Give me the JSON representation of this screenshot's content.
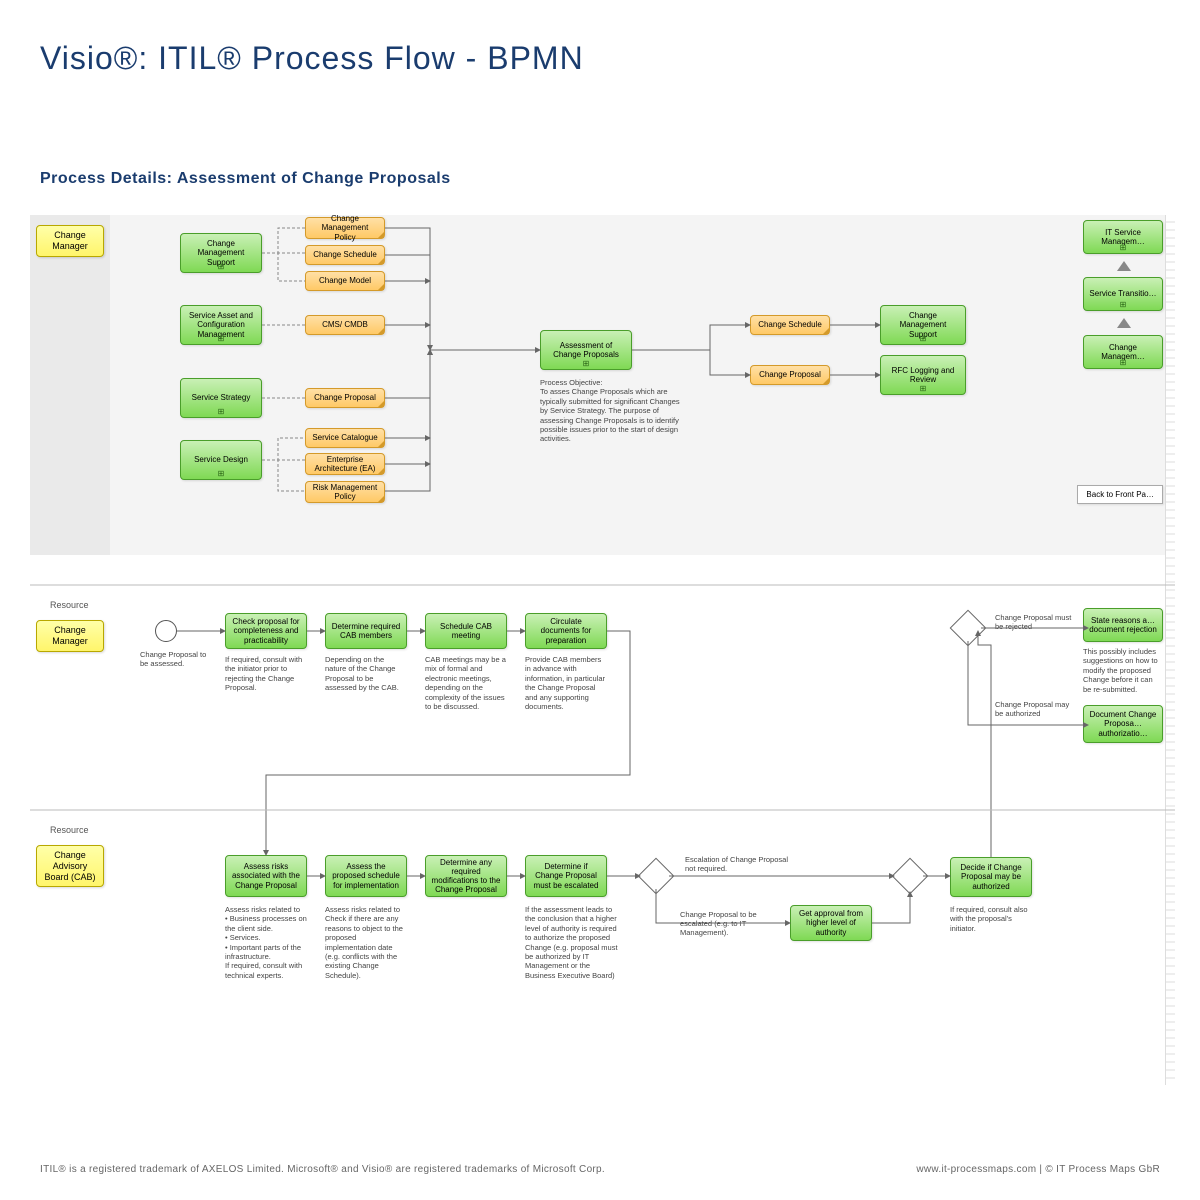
{
  "title": "Visio®: ITIL® Process Flow - BPMN",
  "subtitle": "Process Details: Assessment of Change Proposals",
  "roles": {
    "top": "Change Manager",
    "mid": "Change Manager",
    "bot": "Change Advisory Board (CAB)",
    "resource": "Resource"
  },
  "green_inputs": [
    "Change Management Support",
    "Service Asset and Configuration Management",
    "Service Strategy",
    "Service Design"
  ],
  "orange_inputs": [
    "Change Management Policy",
    "Change Schedule",
    "Change Model",
    "CMS/ CMDB",
    "Change Proposal",
    "Service Catalogue",
    "Enterprise Architecture (EA)",
    "Risk Management Policy"
  ],
  "center_box": "Assessment of Change Proposals",
  "objective": "Process Objective:\nTo asses Change Proposals which are typically submitted for significant Changes by Service Strategy. The purpose of assessing Change Proposals is to identify possible issues prior to the start of design activities.",
  "orange_outputs": [
    "Change Schedule",
    "Change Proposal"
  ],
  "green_outputs": [
    "Change Management Support",
    "RFC Logging and Review"
  ],
  "right_green": [
    "IT Service Managem…",
    "Service Transitio…",
    "Change Managem…"
  ],
  "back_btn": "Back to Front Pa…",
  "seq1": {
    "start_note": "Change Proposal to be assessed.",
    "tasks": [
      "Check proposal for completeness and practicability",
      "Determine required CAB members",
      "Schedule CAB meeting",
      "Circulate documents for preparation"
    ],
    "notes": [
      "If required, consult with the initiator prior to rejecting the Change Proposal.",
      "Depending on the nature of the Change Proposal to be assessed by the CAB.",
      "CAB meetings may be a mix of formal and electronic meetings, depending on the complexity of the issues to be discussed.",
      "Provide CAB members in advance with information, in particular the Change Proposal and any supporting documents."
    ],
    "edge_reject": "Change Proposal must be rejected",
    "edge_auth": "Change Proposal may be authorized",
    "out_reject": "State reasons a… document rejection",
    "out_auth": "Document Change Proposa… authorizatio…",
    "reject_note": "This possibly includes suggestions on how to modify the proposed Change before it can be re-submitted."
  },
  "seq2": {
    "tasks": [
      "Assess risks associated with the Change Proposal",
      "Assess the proposed schedule for implementation",
      "Determine any required modifications to the Change Proposal",
      "Determine if Change Proposal must be escalated"
    ],
    "notes": [
      "Assess risks related to\n• Business processes on the client side.\n• Services.\n• Important parts of the infrastructure.\nIf required, consult with technical experts.",
      "Assess risks related to Check if there are any reasons to object to the proposed implementation date (e.g. conflicts with the existing Change Schedule).",
      "",
      "If the assessment leads to the conclusion that a higher level of authority is required to authorize the proposed Change (e.g. proposal must be authorized by IT Management or the Business Executive Board)"
    ],
    "edge_noesc": "Escalation of Change Proposal not required.",
    "edge_esc": "Change Proposal to be escalated (e.g. to IT Management).",
    "approval": "Get approval from higher level of authority",
    "decide": "Decide if Change Proposal may be authorized",
    "decide_note": "If required, consult also with the proposal's initiator."
  },
  "footer_left": "ITIL® is a registered trademark of AXELOS Limited. Microsoft® and Visio® are registered trademarks of Microsoft Corp.",
  "footer_right": "www.it-processmaps.com | © IT Process Maps GbR"
}
